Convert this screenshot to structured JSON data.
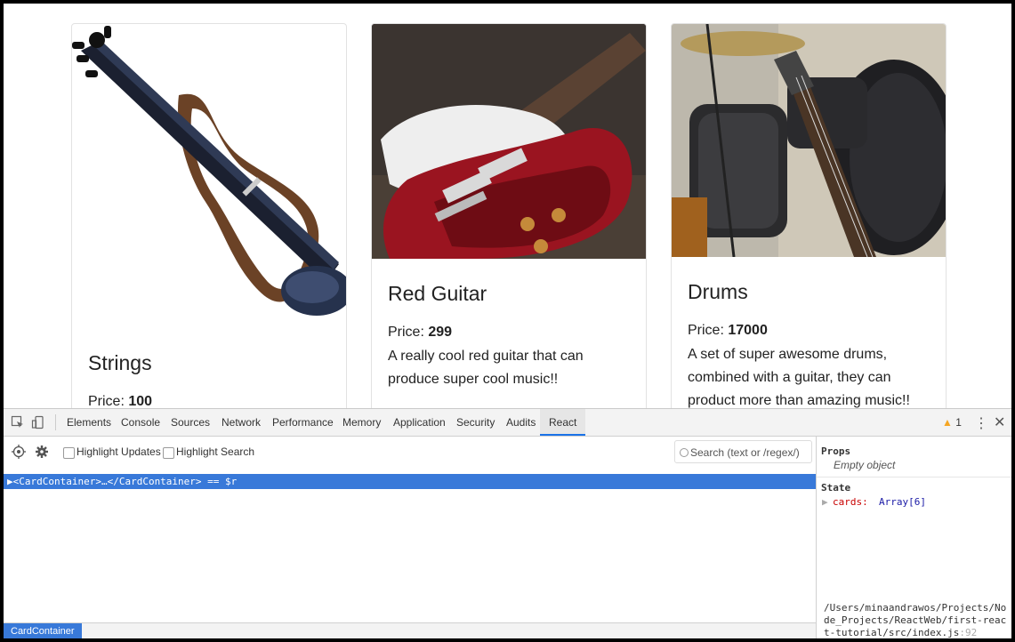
{
  "cards": [
    {
      "title": "Strings",
      "price_label": "Price: ",
      "price": "100",
      "description": ""
    },
    {
      "title": "Red Guitar",
      "price_label": "Price: ",
      "price": "299",
      "description": "A really cool red guitar that can produce super cool music!!"
    },
    {
      "title": "Drums",
      "price_label": "Price: ",
      "price": "17000",
      "description": "A set of super awesome drums, combined with a guitar, they can product more than amazing music!!"
    }
  ],
  "devtools": {
    "tabs": [
      "Elements",
      "Console",
      "Sources",
      "Network",
      "Performance",
      "Memory",
      "Application",
      "Security",
      "Audits",
      "React"
    ],
    "active_tab": "React",
    "warning_count": "1",
    "toolbar": {
      "highlight_updates": "Highlight Updates",
      "highlight_search": "Highlight Search",
      "search_placeholder": "Search (text or /regex/)"
    },
    "tree_row": "▶<CardContainer>…</CardContainer> == $r",
    "breadcrumb": "CardContainer",
    "sidepanel": {
      "props_title": "Props",
      "props_value": "Empty object",
      "state_title": "State",
      "state_key": "cards",
      "state_value": "Array[6]",
      "source_path": "/Users/minaandrawos/Projects/Node_Projects/ReactWeb/first-react-tutorial/src/index.js",
      "source_line": ":92"
    }
  },
  "colors": {
    "accent": "#3879d9",
    "warning": "#f5a623",
    "state_key": "#c80000",
    "state_value": "#1a1aa6"
  }
}
